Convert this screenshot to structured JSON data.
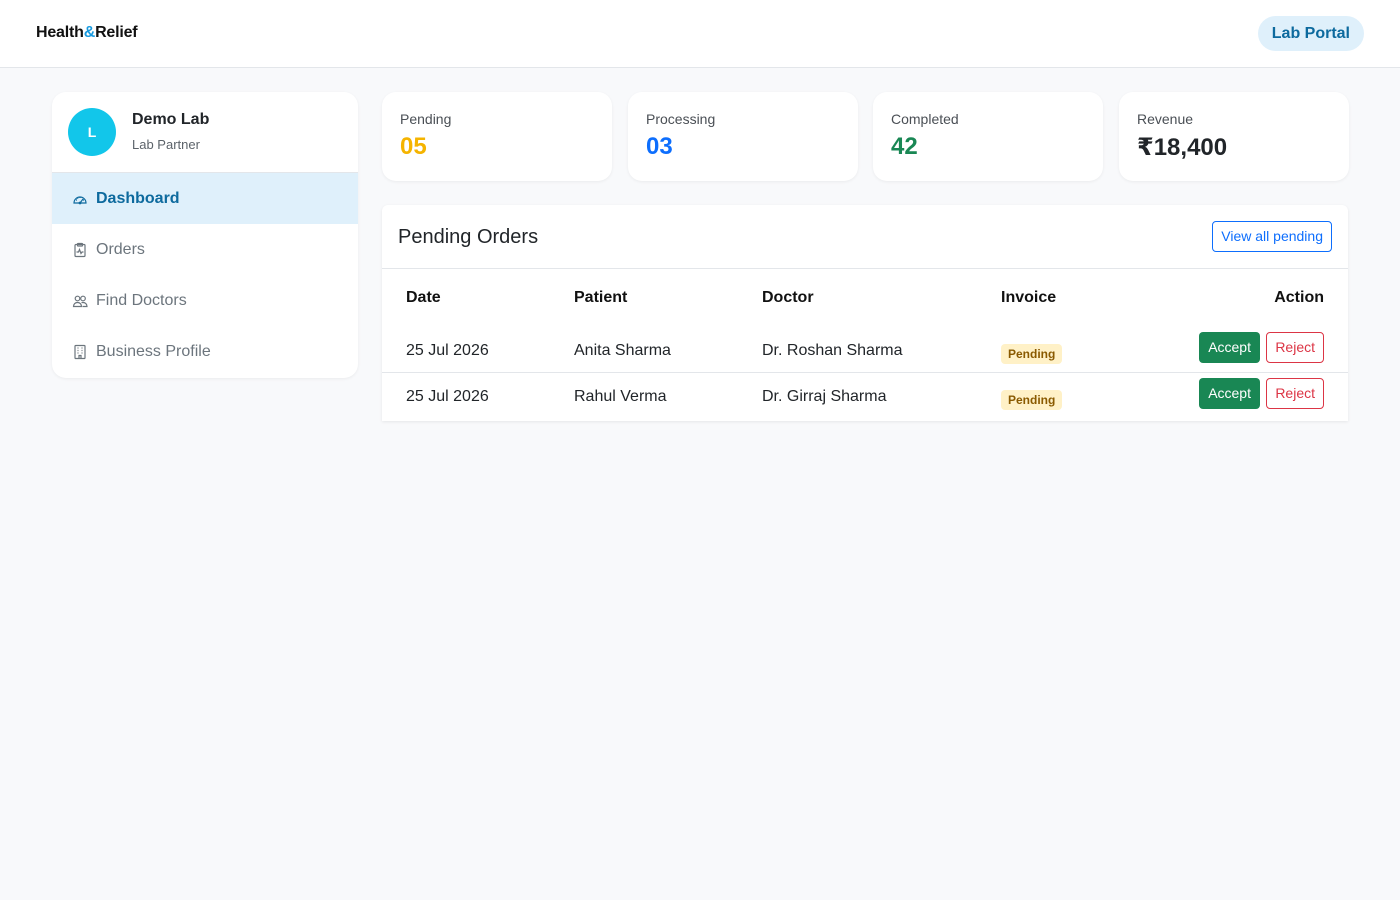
{
  "header": {
    "brand_part1": "Health",
    "brand_amp": "&",
    "brand_part2": "Relief",
    "portal_label": "Lab Portal"
  },
  "sidebar": {
    "avatar_initial": "L",
    "name": "Demo Lab",
    "role": "Lab Partner",
    "items": [
      {
        "label": "Dashboard",
        "icon": "speedometer-icon",
        "active": true
      },
      {
        "label": "Orders",
        "icon": "clipboard-pulse-icon",
        "active": false
      },
      {
        "label": "Find Doctors",
        "icon": "people-icon",
        "active": false
      },
      {
        "label": "Business Profile",
        "icon": "building-icon",
        "active": false
      }
    ]
  },
  "stats": [
    {
      "label": "Pending",
      "value": "05",
      "color": "#f5b400"
    },
    {
      "label": "Processing",
      "value": "03",
      "color": "#0d6efd"
    },
    {
      "label": "Completed",
      "value": "42",
      "color": "#198754"
    },
    {
      "label": "Revenue",
      "value": "₹18,400",
      "color": "#212529"
    }
  ],
  "orders": {
    "title": "Pending Orders",
    "view_all_label": "View all pending",
    "columns": [
      "Date",
      "Patient",
      "Doctor",
      "Invoice",
      "Action"
    ],
    "rows": [
      {
        "date": "25 Jul 2026",
        "patient": "Anita Sharma",
        "doctor": "Dr. Roshan Sharma",
        "invoice": "Pending",
        "accept": "Accept",
        "reject": "Reject"
      },
      {
        "date": "25 Jul 2026",
        "patient": "Rahul Verma",
        "doctor": "Dr. Girraj Sharma",
        "invoice": "Pending",
        "accept": "Accept",
        "reject": "Reject"
      }
    ]
  },
  "colors": {
    "accent": "#1a9be0",
    "active_nav_bg": "#dff0fb",
    "accept": "#198754",
    "reject": "#dc3545",
    "badge_bg": "#fff1c7"
  }
}
